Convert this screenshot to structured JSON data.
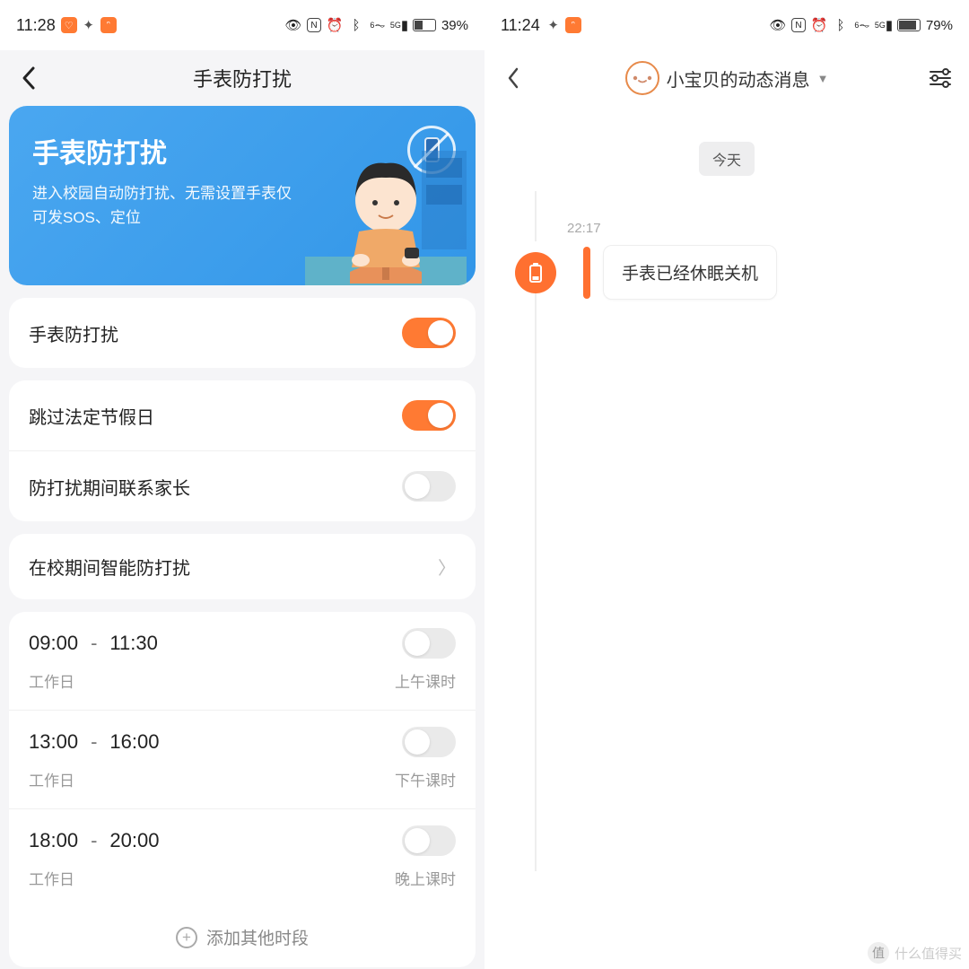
{
  "left": {
    "status": {
      "time": "11:28",
      "battery": "39%"
    },
    "header": {
      "title": "手表防打扰"
    },
    "banner": {
      "title": "手表防打扰",
      "subtitle": "进入校园自动防打扰、无需设置手表仅可发SOS、定位"
    },
    "toggles": {
      "main": {
        "label": "手表防打扰",
        "on": true
      },
      "holiday": {
        "label": "跳过法定节假日",
        "on": true
      },
      "contact": {
        "label": "防打扰期间联系家长",
        "on": false
      }
    },
    "nav": {
      "school": "在校期间智能防打扰"
    },
    "slots": [
      {
        "from": "09:00",
        "to": "11:30",
        "days": "工作日",
        "label": "上午课时",
        "on": false
      },
      {
        "from": "13:00",
        "to": "16:00",
        "days": "工作日",
        "label": "下午课时",
        "on": false
      },
      {
        "from": "18:00",
        "to": "20:00",
        "days": "工作日",
        "label": "晚上课时",
        "on": false
      }
    ],
    "add_label": "添加其他时段"
  },
  "right": {
    "status": {
      "time": "11:24",
      "battery": "79%"
    },
    "header": {
      "name": "小宝贝的动态消息"
    },
    "day": "今天",
    "event": {
      "time": "22:17",
      "text": "手表已经休眠关机"
    }
  },
  "watermark": "什么值得买"
}
